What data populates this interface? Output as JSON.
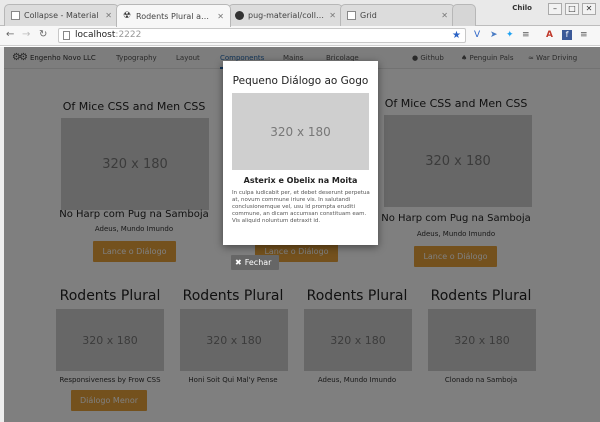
{
  "browser": {
    "tabs": [
      {
        "label": "Collapse - Material"
      },
      {
        "label": "Rodents Plural and No"
      },
      {
        "label": "pug-material/collapsi"
      },
      {
        "label": "Grid"
      }
    ],
    "user": "Chilo",
    "url_host": "localhost",
    "url_port": ":2222"
  },
  "navbar": {
    "brand": "Engenho Novo LLC",
    "links": [
      "Typography",
      "Layout",
      "Components",
      "Mains",
      "Bricolage"
    ],
    "right_links": [
      "Github",
      "Penguin Pals",
      "War Driving"
    ]
  },
  "cards_top": [
    {
      "title": "Of Mice CSS and Men CSS",
      "image": "320 x 180",
      "subtitle": "No Harp com Pug na Samboja",
      "caption": "Adeus, Mundo Imundo",
      "button": "Lance o Diálogo"
    },
    {
      "title": "",
      "image": "",
      "subtitle": "",
      "caption": "",
      "button": "Lance o Diálogo"
    },
    {
      "title": "Of Mice CSS and Men CSS",
      "image": "320 x 180",
      "subtitle": "No Harp com Pug na Samboja",
      "caption": "Adeus, Mundo Imundo",
      "button": "Lance o Diálogo"
    }
  ],
  "cards_bottom": [
    {
      "title": "Rodents Plural",
      "image": "320 x 180",
      "caption": "Responsiveness by Frow CSS",
      "button": "Diálogo Menor"
    },
    {
      "title": "Rodents Plural",
      "image": "320 x 180",
      "caption": "Honi Soit Qui Mal'y Pense"
    },
    {
      "title": "Rodents Plural",
      "image": "320 x 180",
      "caption": "Adeus, Mundo Imundo"
    },
    {
      "title": "Rodents Plural",
      "image": "320 x 180",
      "caption": "Clonado na Samboja"
    }
  ],
  "modal": {
    "title": "Pequeno Diálogo ao Gogo",
    "image": "320 x 180",
    "subtitle": "Asterix e Obelix na Moita",
    "body": "In culpa iudicabit per, et debet deserunt perpetua at, novum commune iriure vis. In salutandi conclusionemque vel, usu id prompta eruditi commune, an dicam accumsan constituam eam. Vis aliquid noluntum detraxit id.",
    "close_label": "Fechar"
  },
  "colors": {
    "accent": "#e8a23a",
    "link_active": "#2a6fb5",
    "placeholder": "#cfcfcf"
  }
}
